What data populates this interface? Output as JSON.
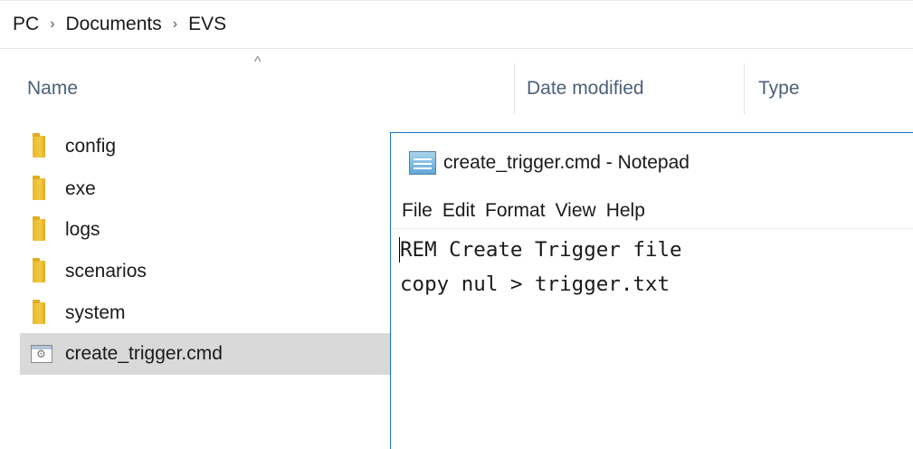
{
  "breadcrumb": {
    "items": [
      "PC",
      "Documents",
      "EVS"
    ],
    "separator": "›"
  },
  "columns": {
    "name": "Name",
    "date_modified": "Date modified",
    "type": "Type",
    "sort_indicator": "^"
  },
  "files": [
    {
      "name": "config",
      "kind": "folder"
    },
    {
      "name": "exe",
      "kind": "folder"
    },
    {
      "name": "logs",
      "kind": "folder"
    },
    {
      "name": "scenarios",
      "kind": "folder"
    },
    {
      "name": "system",
      "kind": "folder"
    },
    {
      "name": "create_trigger.cmd",
      "kind": "cmd-file",
      "selected": true
    }
  ],
  "notepad": {
    "title": "create_trigger.cmd - Notepad",
    "menu": [
      "File",
      "Edit",
      "Format",
      "View",
      "Help"
    ],
    "lines": [
      "REM Create Trigger file",
      "copy nul > trigger.txt"
    ]
  },
  "colors": {
    "accent_border": "#1e74d0",
    "header_text": "#4c607a",
    "selection": "#d9d9d9",
    "folder": "#f3c944"
  }
}
